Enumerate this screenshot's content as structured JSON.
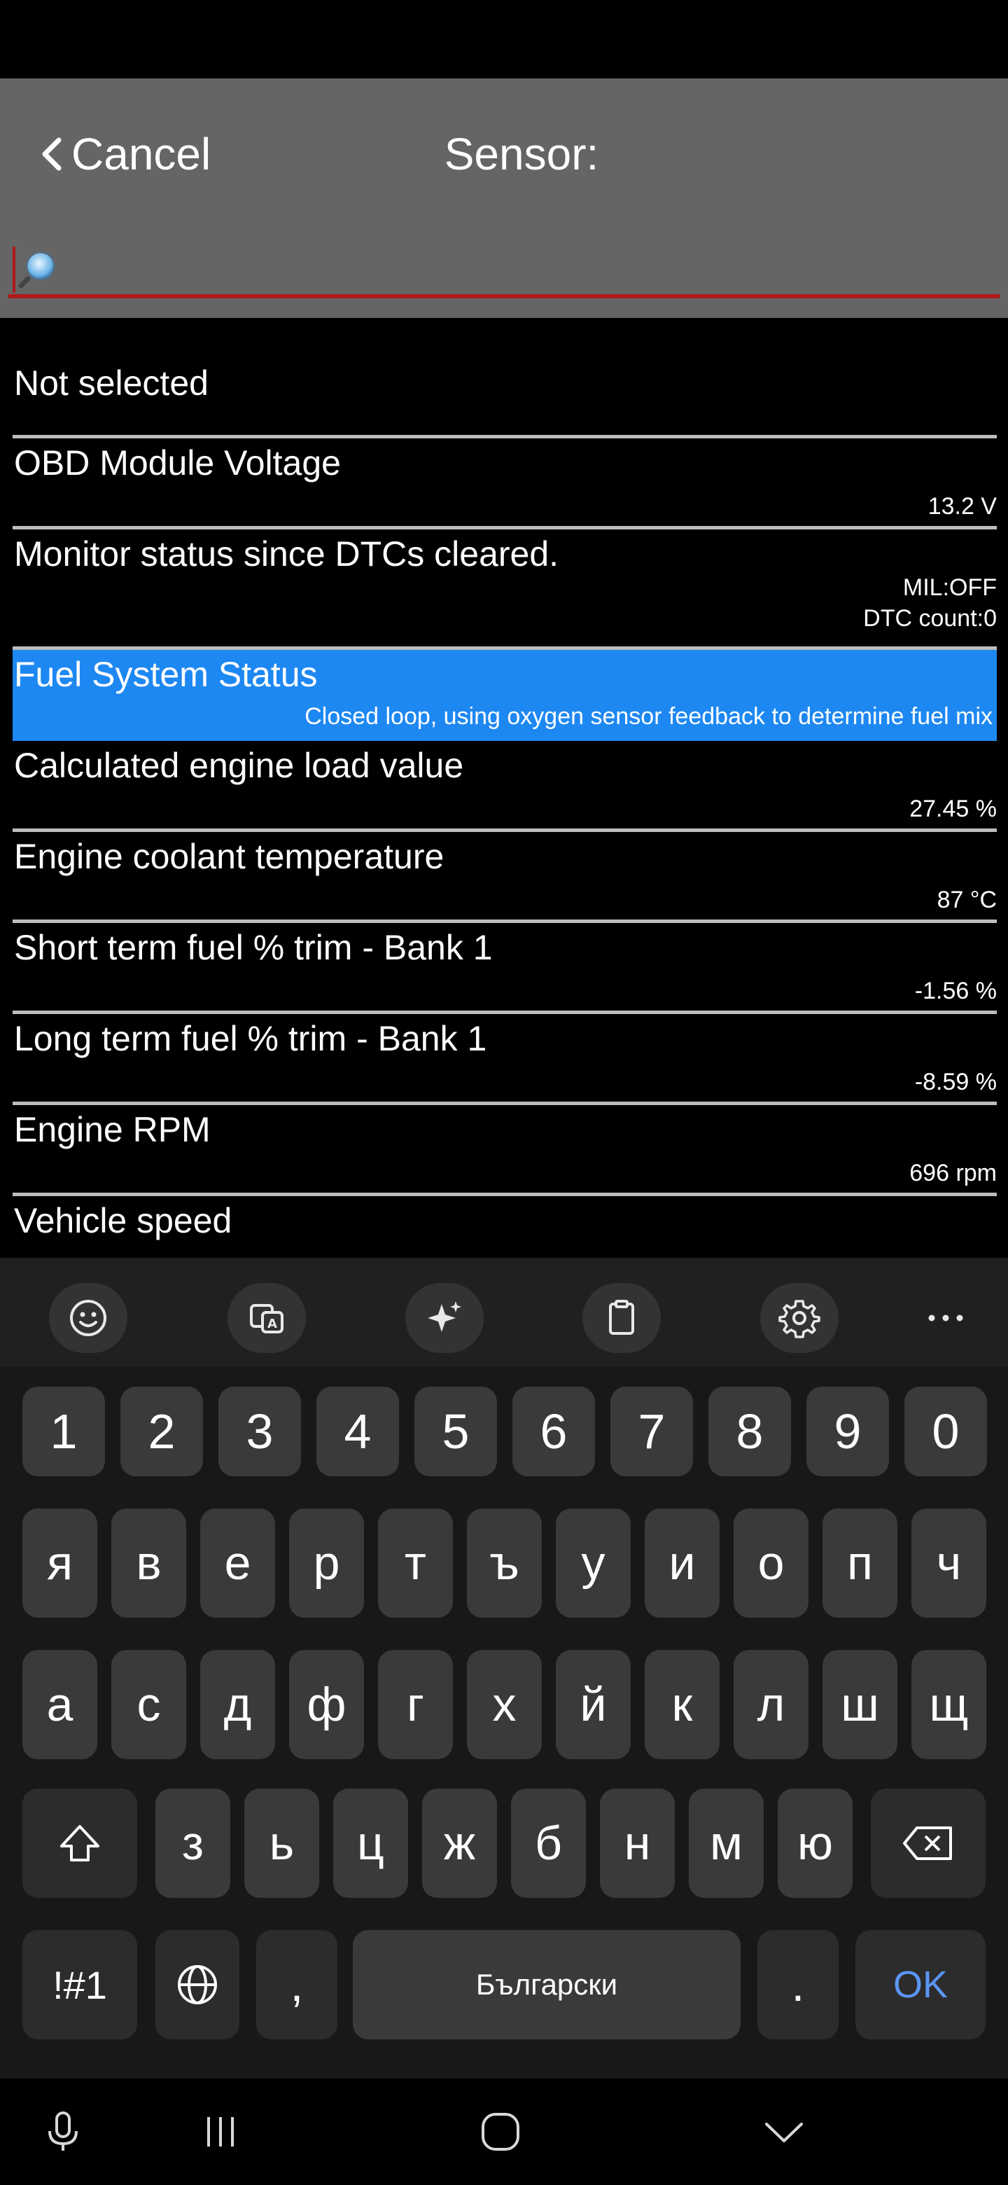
{
  "header": {
    "cancel_label": "Cancel",
    "title": "Sensor:",
    "search_value": ""
  },
  "sensors": [
    {
      "name": "Not selected",
      "value": "",
      "value2": ""
    },
    {
      "name": "OBD Module Voltage",
      "value": "13.2 V",
      "value2": ""
    },
    {
      "name": "Monitor status since DTCs cleared.",
      "value": "MIL:OFF",
      "value2": "DTC count:0"
    },
    {
      "name": "Fuel System Status",
      "value": "Closed loop, using oxygen sensor feedback to determine fuel mix",
      "value2": "",
      "selected": true
    },
    {
      "name": "Calculated engine load value",
      "value": "27.45 %",
      "value2": ""
    },
    {
      "name": "Engine coolant temperature",
      "value": "87 °C",
      "value2": ""
    },
    {
      "name": "Short term fuel % trim - Bank 1",
      "value": "-1.56 %",
      "value2": ""
    },
    {
      "name": "Long term fuel % trim - Bank 1",
      "value": "-8.59 %",
      "value2": ""
    },
    {
      "name": "Engine RPM",
      "value": "696 rpm",
      "value2": ""
    },
    {
      "name": "Vehicle speed",
      "value": "",
      "value2": ""
    }
  ],
  "keyboard": {
    "toolbar_icons": [
      "emoji-icon",
      "translate-icon",
      "sparkle-icon",
      "clipboard-icon",
      "gear-icon",
      "more-icon"
    ],
    "number_row": [
      "1",
      "2",
      "3",
      "4",
      "5",
      "6",
      "7",
      "8",
      "9",
      "0"
    ],
    "row1": [
      "я",
      "в",
      "е",
      "р",
      "т",
      "ъ",
      "у",
      "и",
      "о",
      "п",
      "ч"
    ],
    "row2": [
      "а",
      "с",
      "д",
      "ф",
      "г",
      "х",
      "й",
      "к",
      "л",
      "ш",
      "щ"
    ],
    "row3": [
      "з",
      "ь",
      "ц",
      "ж",
      "б",
      "н",
      "м",
      "ю"
    ],
    "symbols_label": "!#1",
    "comma_label": ",",
    "space_label": "Български",
    "period_label": ".",
    "ok_label": "OK"
  },
  "navbar": {
    "icons": [
      "microphone-icon",
      "recents-icon",
      "home-icon",
      "hide-keyboard-icon"
    ]
  },
  "colors": {
    "header_bg": "#656565",
    "search_underline": "#b01a1a",
    "selected_row": "#1e88f2",
    "ok_text": "#5a96f5"
  }
}
